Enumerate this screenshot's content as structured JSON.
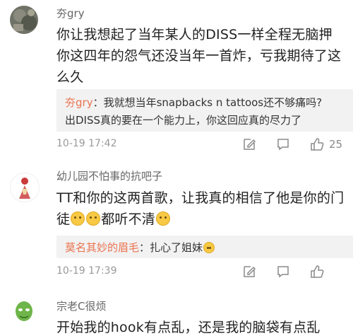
{
  "comments": [
    {
      "username": "夯gry",
      "body_lines": [
        "你让我想起了当年某人的DISS一样全程无脑押",
        "你这四年的怨气还没当年一首炸，亏我期待了这",
        "么久"
      ],
      "reply": {
        "user": "夯gry",
        "lines": [
          "：我就想当年snapbacks n tattoos还不够痛吗?",
          "出DISS真的要在一个能力上，你这回应真的尽力了"
        ]
      },
      "timestamp": "10-19 17:42",
      "likes": "25"
    },
    {
      "username": "幼儿园不怕事的抗吧子",
      "body_line1": "TT和你的这两首歌，让我真的相信了他是你的门",
      "body_line2_start": "徒",
      "body_line2_end": "都听不清",
      "emojis": [
        "laugh-tears-emoji",
        "laugh-tears-emoji",
        "laugh-tears-emoji"
      ],
      "reply": {
        "user": "莫名其妙的眉毛",
        "text": "：扎心了姐妹"
      },
      "timestamp": "10-19 17:39"
    },
    {
      "username": "宗老C很烦",
      "body_partial": "开始我的hook有点乱，还是我的脑袋有点乱"
    }
  ],
  "colors": {
    "username": "#666666",
    "body": "#222222",
    "reply_username": "#eb7350",
    "reply_bg": "#f2f2f2",
    "meta": "#999999"
  },
  "icons": [
    "edit-icon",
    "comment-icon",
    "like-icon"
  ]
}
